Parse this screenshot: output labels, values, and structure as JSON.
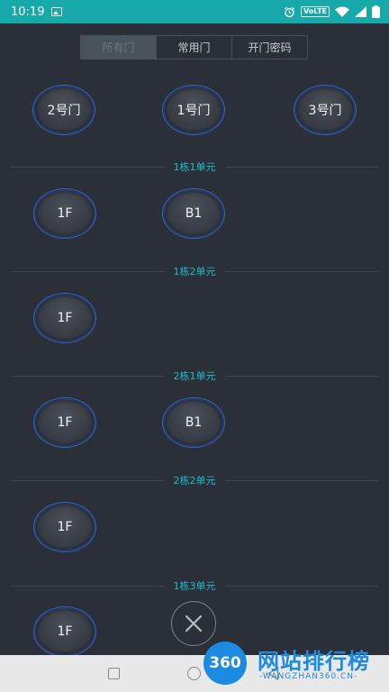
{
  "status_bar": {
    "time": "10:19",
    "volte": "VoLTE",
    "icons": [
      "image-icon",
      "alarm-icon",
      "volte-icon",
      "wifi-icon",
      "signal-icon",
      "battery-icon"
    ]
  },
  "tabs": [
    {
      "label": "所有门",
      "active": true
    },
    {
      "label": "常用门",
      "active": false
    },
    {
      "label": "开门密码",
      "active": false
    }
  ],
  "top_doors": [
    "2号门",
    "1号门",
    "3号门"
  ],
  "sections": [
    {
      "title": "1栋1单元",
      "doors": [
        "1F",
        "B1"
      ]
    },
    {
      "title": "1栋2单元",
      "doors": [
        "1F"
      ]
    },
    {
      "title": "2栋1单元",
      "doors": [
        "1F",
        "B1"
      ]
    },
    {
      "title": "2栋2单元",
      "doors": [
        "1F"
      ]
    },
    {
      "title": "1栋3单元",
      "doors": [
        "1F"
      ]
    }
  ],
  "close_icon": "close-icon",
  "nav_bar": {
    "icons": [
      "recents-icon",
      "home-icon",
      "back-icon"
    ]
  },
  "watermark": {
    "badge": "360",
    "title": "网站排行榜",
    "subtitle": "-WANGZHAN360.CN-"
  },
  "colors": {
    "status_bar": "#17a9a9",
    "background": "#2b3038",
    "section_label": "#1fbcc8",
    "door_ring": "#3a63b8",
    "watermark": "#1a8be0"
  }
}
